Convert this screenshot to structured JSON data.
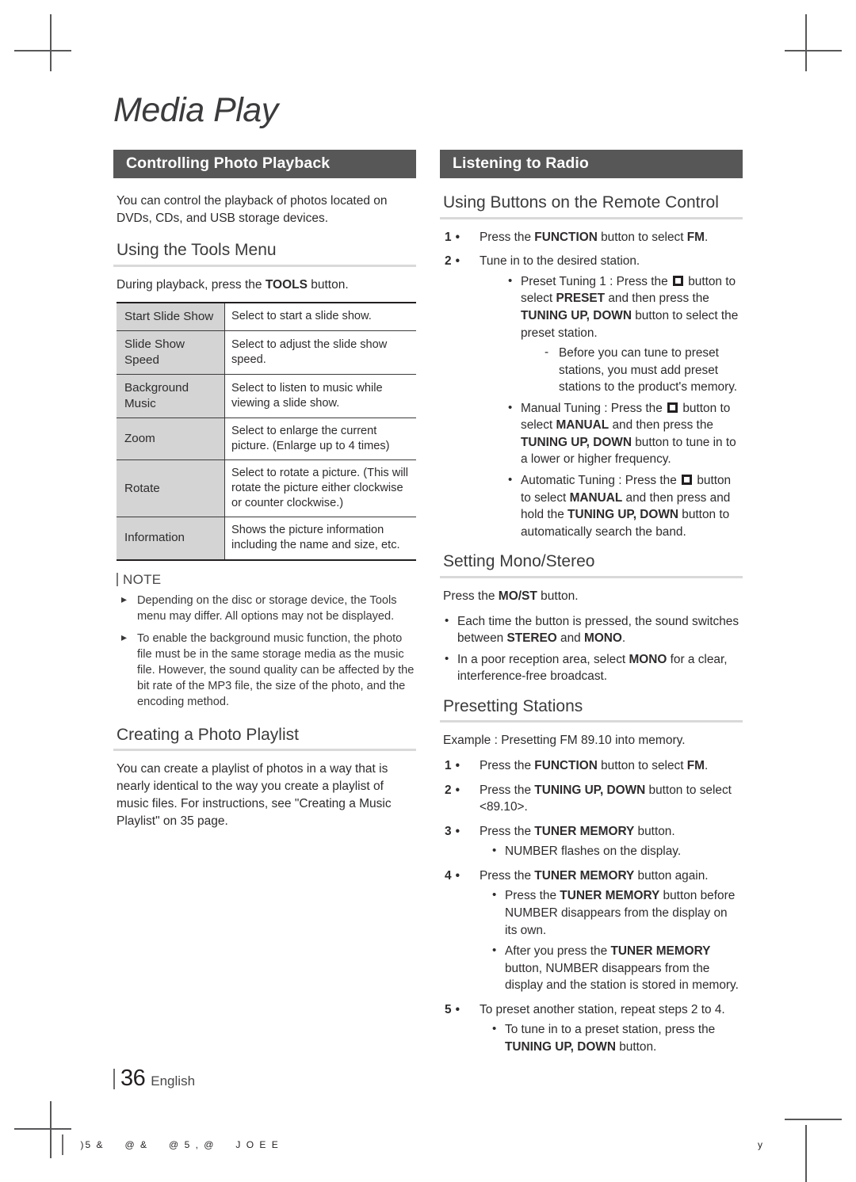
{
  "chapter": {
    "title": "Media Play"
  },
  "left": {
    "section_title": "Controlling Photo Playback",
    "intro": "You can control the playback of photos located on DVDs, CDs, and USB storage devices.",
    "tools": {
      "heading": "Using the Tools Menu",
      "lead_pre": "During playback, press the ",
      "lead_bold": "TOOLS",
      "lead_post": " button.",
      "rows": [
        {
          "key": "Start Slide Show",
          "desc": "Select to start a slide show."
        },
        {
          "key": "Slide Show Speed",
          "desc": "Select to adjust the slide show speed."
        },
        {
          "key": "Background Music",
          "desc": "Select to listen to music while viewing a slide show."
        },
        {
          "key": "Zoom",
          "desc": "Select to enlarge the current picture. (Enlarge up to 4 times)"
        },
        {
          "key": "Rotate",
          "desc": "Select to rotate a picture. (This will rotate the picture either clockwise or counter clockwise.)"
        },
        {
          "key": "Information",
          "desc": "Shows the picture information including the name and size, etc."
        }
      ]
    },
    "note": {
      "label": "NOTE",
      "items": [
        "Depending on the disc or storage device, the Tools menu may differ. All options may not be displayed.",
        "To enable the background music function, the photo file must be in the same storage media as the music file. However, the sound quality can be affected by the bit rate of the MP3 file, the size of the photo, and the encoding method."
      ]
    },
    "playlist": {
      "heading": "Creating a Photo Playlist",
      "body": "You can create a playlist of photos in a way that is nearly identical to the way you create a playlist of music files. For instructions, see \"Creating a Music Playlist\" on 35 page."
    }
  },
  "right": {
    "section_title": "Listening to Radio",
    "remote": {
      "heading": "Using Buttons on the Remote Control",
      "step1": {
        "num": "1",
        "pre": "Press the ",
        "b1": "FUNCTION",
        "mid": " button to select ",
        "b2": "FM",
        "post": "."
      },
      "step2": {
        "num": "2",
        "text": "Tune in to the desired station."
      },
      "preset": {
        "lead_pre": "Preset Tuning 1 : Press the ",
        "lead_post": " button",
        "l2_pre": "to select ",
        "l2_b": "PRESET",
        "l2_mid": "and then press the ",
        "l3_b": "TUNING UP, DOWN",
        "l3_post": " button to select the preset station.",
        "dash": "Before you can tune to preset stations, you must add preset stations to the product's memory."
      },
      "manual": {
        "lead_pre": "Manual Tuning : Press the ",
        "lead_post": " button",
        "l2_pre": "to select ",
        "l2_b": "MANUAL",
        "l2_mid": " and then press the ",
        "l3_b": "TUNING UP, DOWN",
        "l3_post": " button to tune in to a lower or higher frequency."
      },
      "automatic": {
        "lead_pre": "Automatic Tuning : Press the ",
        "lead_post": " button",
        "l2_pre": "to select ",
        "l2_b": "MANUAL",
        "l2_mid": " and then press and hold the ",
        "l3_b": "TUNING UP, DOWN",
        "l3_post": " button to automatically search the band."
      }
    },
    "mono": {
      "heading": "Setting Mono/Stereo",
      "lead_pre": "Press the ",
      "lead_b": "MO/ST",
      "lead_post": " button.",
      "b1_pre": "Each time the button is pressed, the sound switches between ",
      "b1_b1": "STEREO",
      "b1_mid": "and ",
      "b1_b2": "MONO",
      "b1_post": ".",
      "b2_pre": "In a poor reception area, select ",
      "b2_b": "MONO",
      "b2_post": " for a clear, interference-free broadcast."
    },
    "presetting": {
      "heading": "Presetting Stations",
      "example": "Example : Presetting FM 89.10 into memory.",
      "s1": {
        "num": "1",
        "pre": "Press the ",
        "b1": "FUNCTION",
        "mid": " button to select ",
        "b2": "FM",
        "post": "."
      },
      "s2": {
        "num": "2",
        "pre": "Press the ",
        "b1": "TUNING UP, DOWN",
        "post": " button to select <89.10>."
      },
      "s3": {
        "num": "3",
        "pre": "Press the ",
        "b1": "TUNER MEMORY",
        "post": " button.",
        "sub": "NUMBER flashes on the display."
      },
      "s4": {
        "num": "4",
        "pre": "Press the ",
        "b1": "TUNER MEMORY",
        "post": " button again.",
        "sub1_pre": "Press the ",
        "sub1_b": "TUNER MEMORY",
        "sub1_post": " button before NUMBER disappears from the display on its own.",
        "sub2_pre": "After you press the ",
        "sub2_b": "TUNER MEMORY",
        "sub2_post": " button, NUMBER disappears from the display and the station is stored in memory."
      },
      "s5": {
        "num": "5",
        "text": "To preset another station, repeat steps 2 to 4.",
        "sub_pre": "To tune in to a preset station, press the ",
        "sub_b": "TUNING UP, DOWN",
        "sub_post": " button."
      }
    }
  },
  "footer": {
    "page_number": "36",
    "language": "English",
    "slug_parts": [
      ")5 &",
      "@ &",
      "@ 5 , @",
      "J O E E"
    ],
    "slug_right": "y"
  },
  "colors": {
    "section_bar": "#575757",
    "table_key_bg": "#d4d4d4",
    "rule": "#d9d9d9",
    "text": "#231f20"
  }
}
